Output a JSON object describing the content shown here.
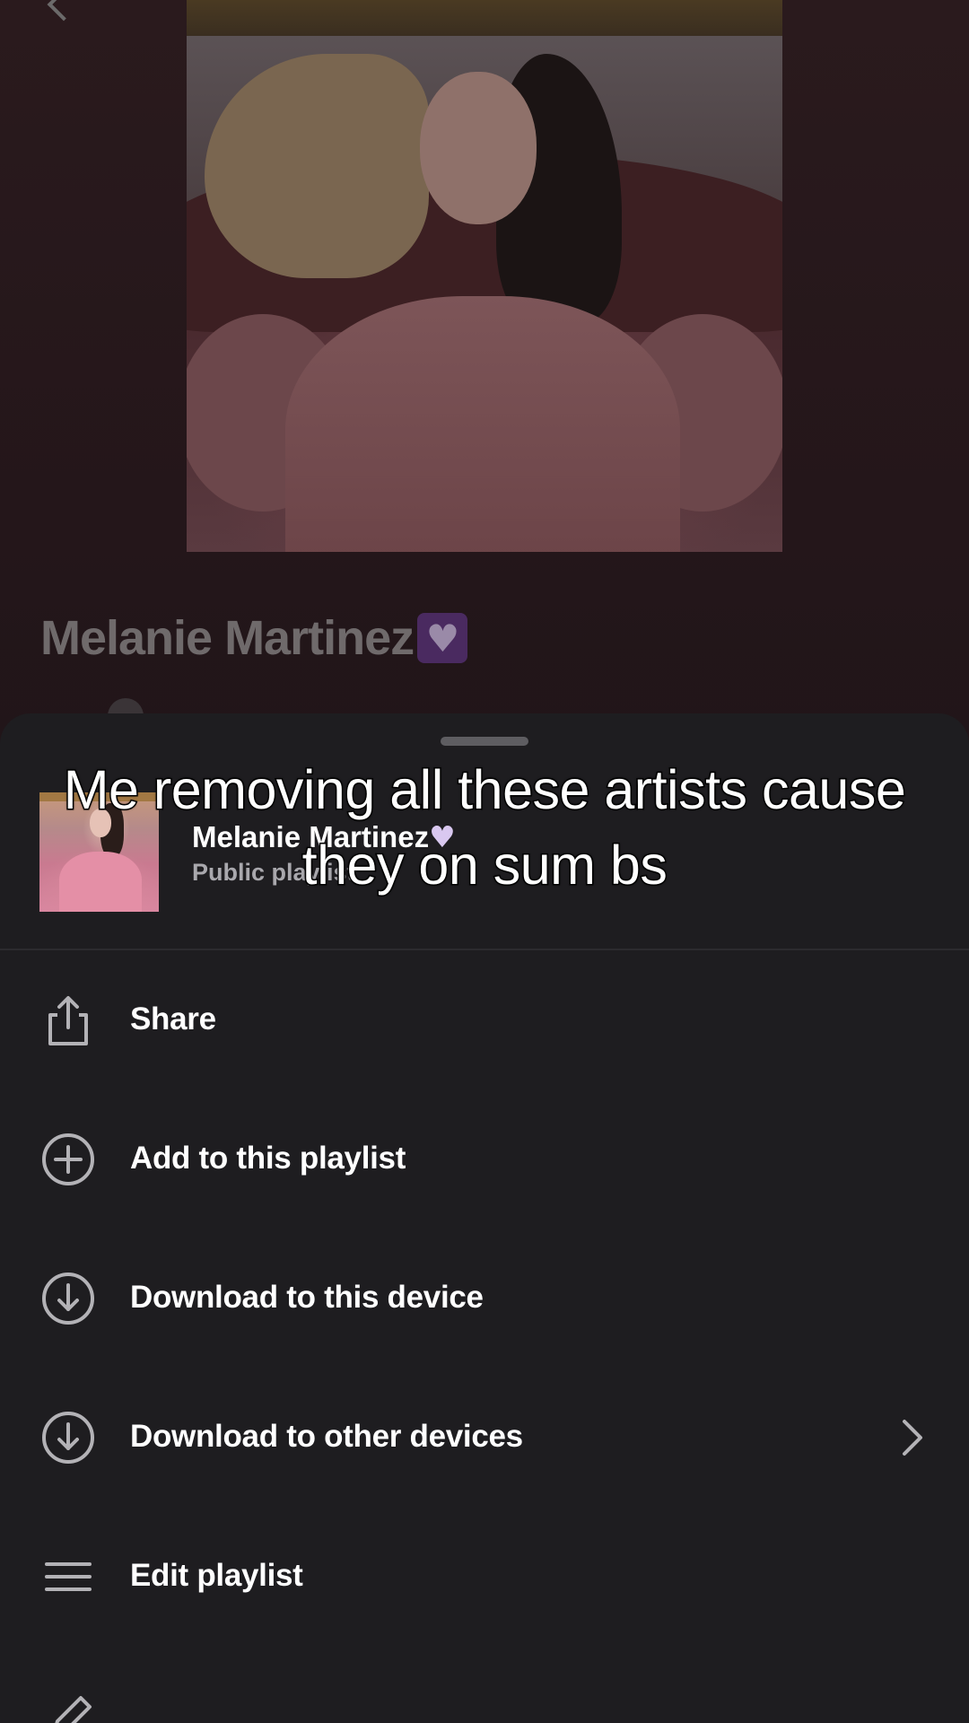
{
  "background": {
    "playlist_title": "Melanie Martinez",
    "heart_emoji": "purple-heart-emoji"
  },
  "sheet": {
    "playlist_name": "Melanie Martinez",
    "heart_emoji": "purple-heart-emoji",
    "playlist_type": "Public playlist",
    "menu": [
      {
        "label": "Share",
        "icon": "share-icon"
      },
      {
        "label": "Add to this playlist",
        "icon": "plus-circle-icon"
      },
      {
        "label": "Download to this device",
        "icon": "download-circle-icon"
      },
      {
        "label": "Download to other devices",
        "icon": "download-circle-icon",
        "trailing": "chevron-right-icon"
      },
      {
        "label": "Edit playlist",
        "icon": "menu-lines-icon"
      },
      {
        "label": "",
        "icon": "pencil-icon"
      }
    ]
  },
  "caption": {
    "text": "Me removing all these artists cause they on sum bs"
  },
  "colors": {
    "sheet_bg": "#1e1d20",
    "text_primary": "#ffffff",
    "text_secondary": "#a9a8ad",
    "icon_stroke": "#b3b2b6"
  }
}
